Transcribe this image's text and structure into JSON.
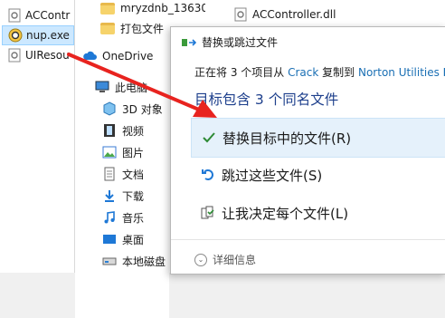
{
  "left_files": [
    {
      "label": "ACContr",
      "icon": "dll-file-icon"
    },
    {
      "label": "nup.exe",
      "icon": "exe-file-icon"
    },
    {
      "label": "UIResou",
      "icon": "dll-file-icon"
    }
  ],
  "explorer": {
    "top_folders": [
      "mryzdnb_13630",
      "打包文件"
    ],
    "right_file": "ACController.dll",
    "nav": [
      {
        "label": "OneDrive",
        "icon": "cloud-icon"
      },
      {
        "label": "此电脑",
        "icon": "computer-icon"
      },
      {
        "label": "3D 对象",
        "icon": "cube-icon"
      },
      {
        "label": "视频",
        "icon": "video-icon"
      },
      {
        "label": "图片",
        "icon": "picture-icon"
      },
      {
        "label": "文档",
        "icon": "document-icon"
      },
      {
        "label": "下载",
        "icon": "download-icon"
      },
      {
        "label": "音乐",
        "icon": "music-icon"
      },
      {
        "label": "桌面",
        "icon": "desktop-icon"
      },
      {
        "label": "本地磁盘",
        "icon": "disk-icon"
      }
    ]
  },
  "dialog": {
    "title": "替换或跳过文件",
    "info_prefix": "正在将 3 个项目从",
    "info_source": "Crack",
    "info_mid": "复制到",
    "info_dest": "Norton Utilities P",
    "heading": "目标包含 3 个同名文件",
    "options": [
      {
        "label": "替换目标中的文件(R)",
        "icon": "checkmark-icon"
      },
      {
        "label": "跳过这些文件(S)",
        "icon": "skip-icon"
      },
      {
        "label": "让我决定每个文件(L)",
        "icon": "decide-icon"
      }
    ],
    "details_label": "详细信息"
  },
  "colors": {
    "accent": "#1a6fb4",
    "heading": "#1d3f8c",
    "highlight": "#e5f1fb",
    "arrow": "#e8231f"
  }
}
